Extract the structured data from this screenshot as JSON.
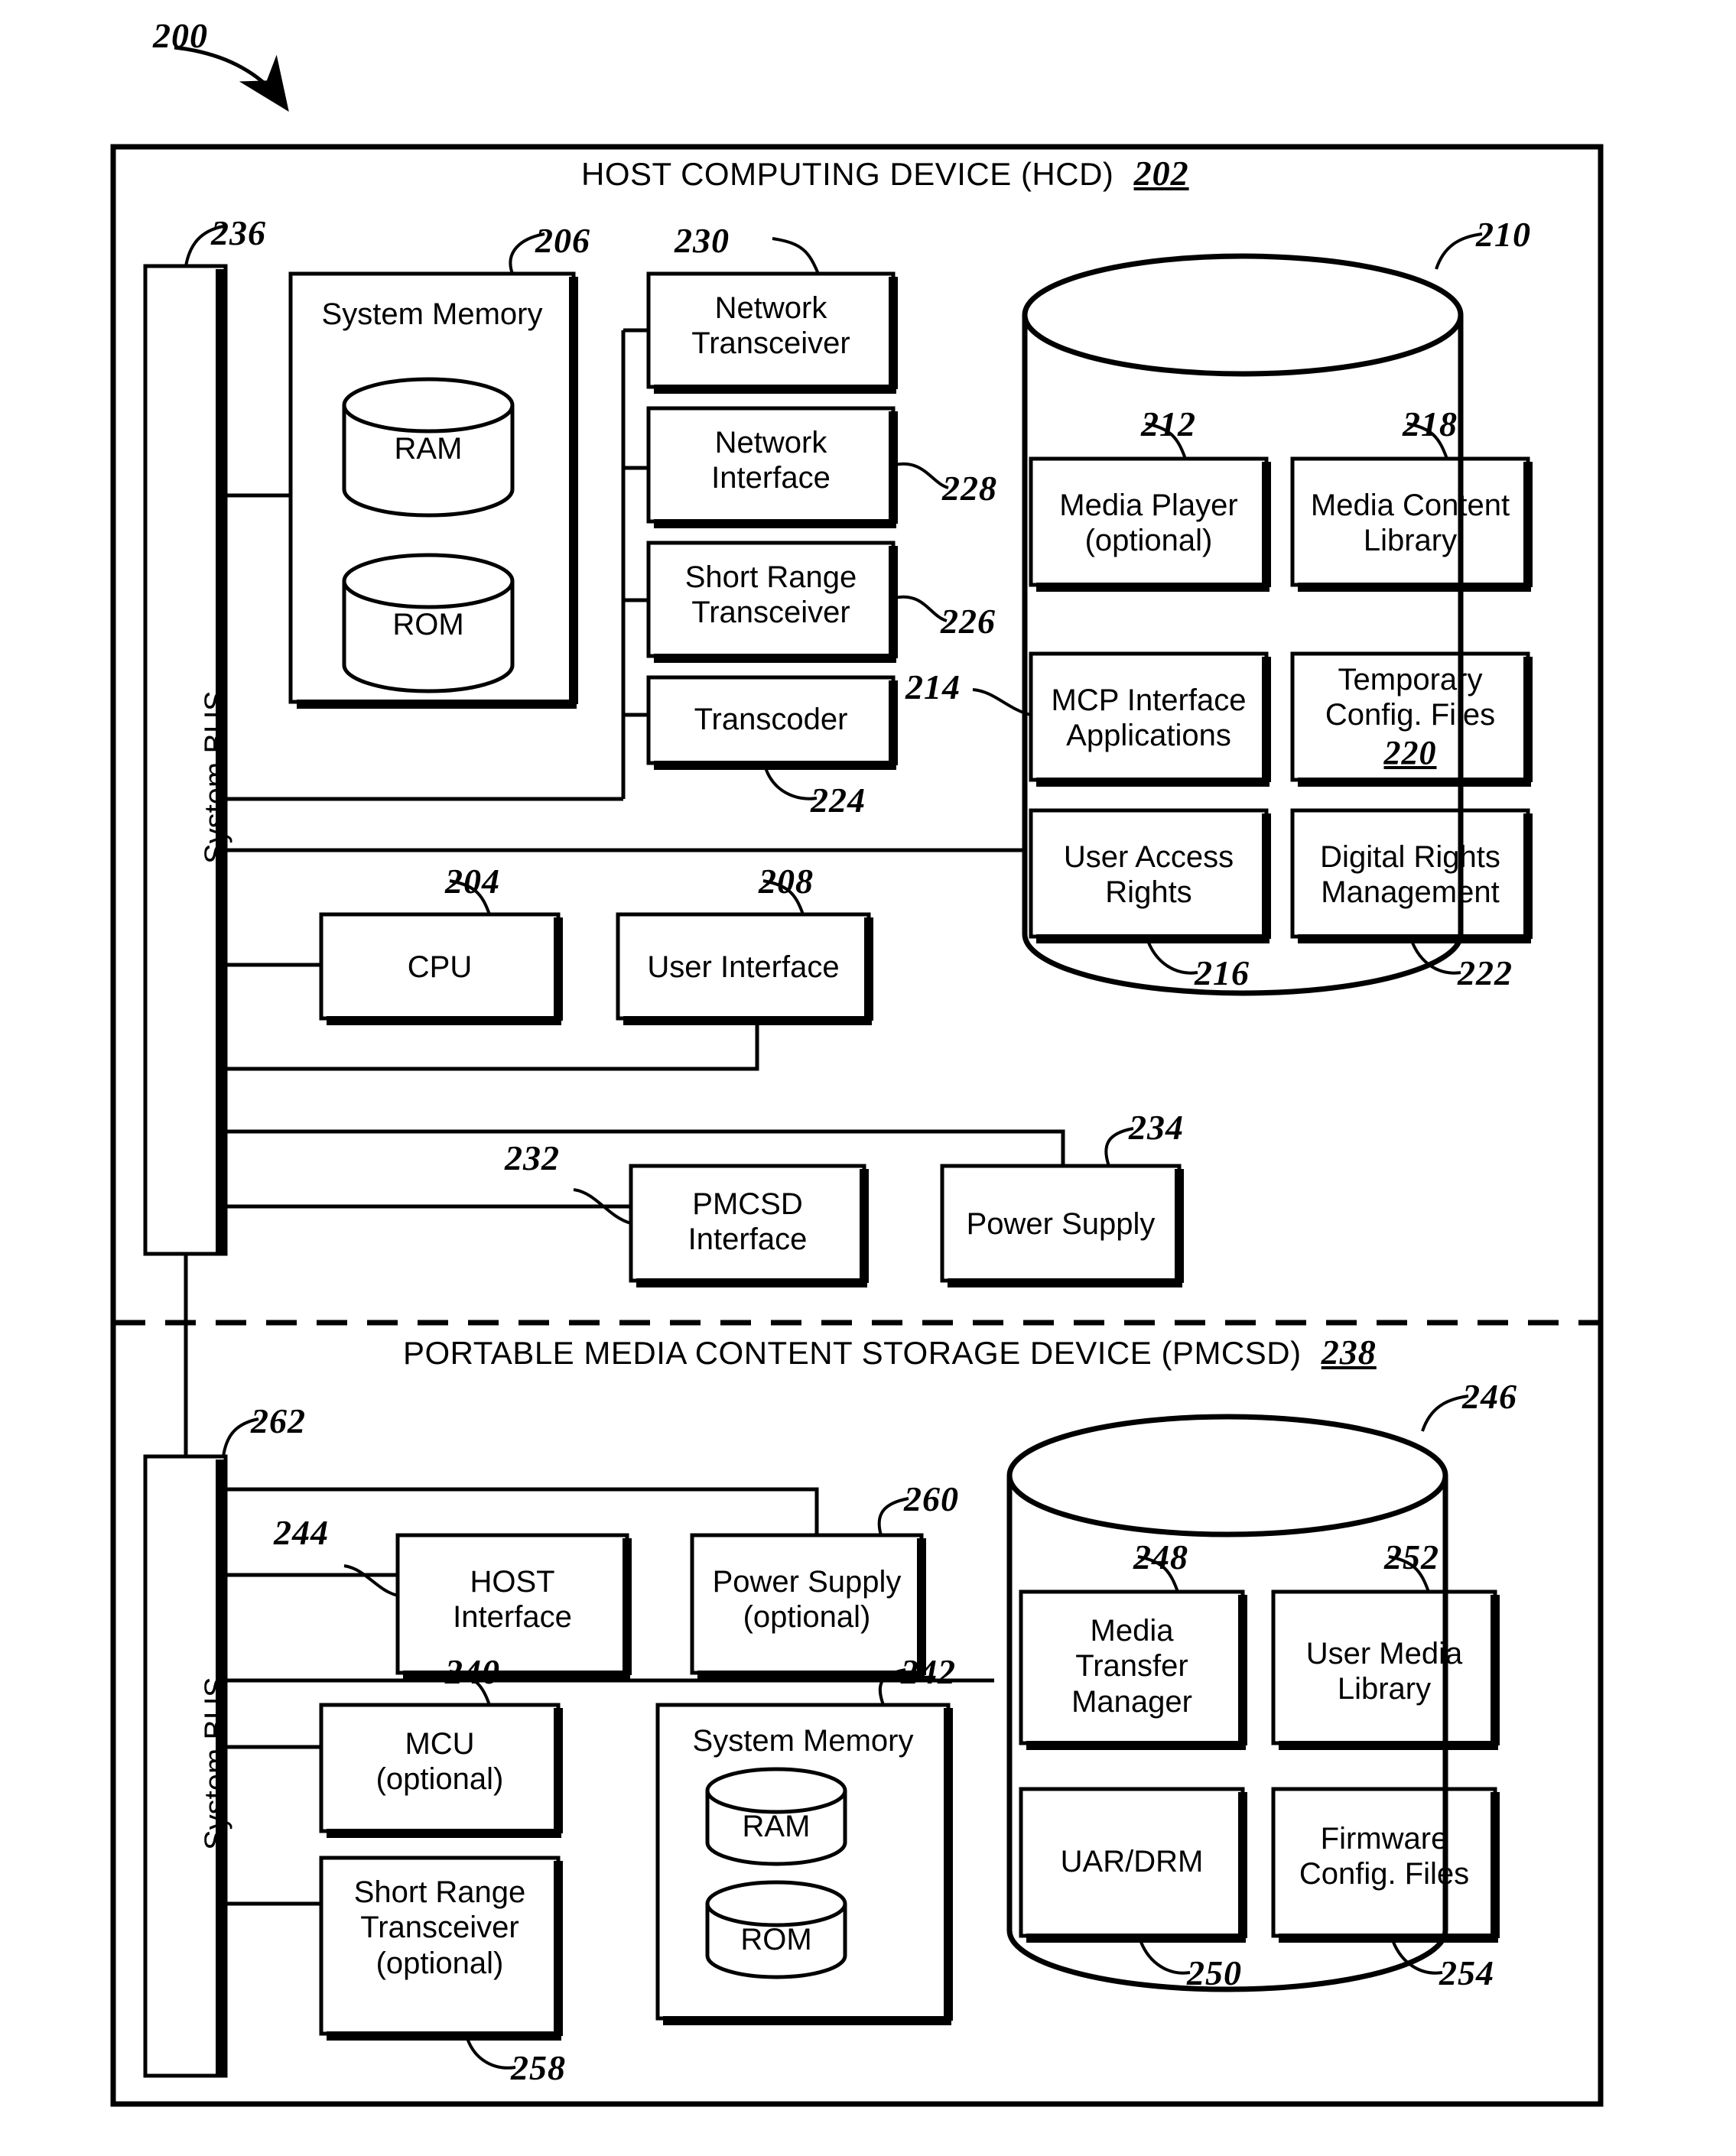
{
  "figure": {
    "figure_ref": "200",
    "sections": [
      {
        "id": "hcd",
        "title": "HOST COMPUTING DEVICE (HCD)",
        "ref": "202"
      },
      {
        "id": "pmcsd",
        "title": "PORTABLE MEDIA CONTENT STORAGE DEVICE (PMCSD)",
        "ref": "238"
      }
    ]
  },
  "hcd": {
    "bus": {
      "label": "System BUS",
      "ref": "236"
    },
    "system_memory": {
      "label": "System Memory",
      "ref": "206",
      "cylinders": [
        {
          "label": "RAM"
        },
        {
          "label": "ROM"
        }
      ]
    },
    "stack": [
      {
        "label": "Network\nTransceiver",
        "lines": [
          "Network",
          "Transceiver"
        ],
        "ref": "230",
        "ref_pos": "top"
      },
      {
        "label": "Network\nInterface",
        "lines": [
          "Network",
          "Interface"
        ],
        "ref": "228",
        "ref_pos": "right"
      },
      {
        "label": "Short Range\nTransceiver",
        "lines": [
          "Short Range",
          "Transceiver"
        ],
        "ref": "226",
        "ref_pos": "right"
      },
      {
        "label": "Transcoder",
        "lines": [
          "Transcoder"
        ],
        "ref": "224",
        "ref_pos": "bottom"
      }
    ],
    "cpu": {
      "label": "CPU",
      "ref": "204"
    },
    "user_interface": {
      "label": "User Interface",
      "ref": "208"
    },
    "pmcsd_interface": {
      "lines": [
        "PMCSD",
        "Interface"
      ],
      "ref": "232"
    },
    "power_supply": {
      "label": "Power Supply",
      "ref": "234"
    },
    "database": {
      "ref": "210",
      "items": [
        {
          "lines": [
            "Media Player",
            "(optional)"
          ],
          "ref": "212",
          "ref_pos": "top"
        },
        {
          "lines": [
            "Media Content",
            "Library"
          ],
          "ref": "218",
          "ref_pos": "top"
        },
        {
          "lines": [
            "MCP Interface",
            "Applications"
          ],
          "ref": "214",
          "ref_pos": "left"
        },
        {
          "lines": [
            "Temporary",
            "Config. Files"
          ],
          "ref": "220",
          "ref_pos": "inside"
        },
        {
          "lines": [
            "User Access",
            "Rights"
          ],
          "ref": "216",
          "ref_pos": "bottom"
        },
        {
          "lines": [
            "Digital Rights",
            "Management"
          ],
          "ref": "222",
          "ref_pos": "bottom"
        }
      ]
    }
  },
  "pmcsd": {
    "bus": {
      "label": "System BUS",
      "ref": "262"
    },
    "host_interface": {
      "lines": [
        "HOST",
        "Interface"
      ],
      "ref": "244"
    },
    "power_supply": {
      "lines": [
        "Power Supply",
        "(optional)"
      ],
      "ref": "260"
    },
    "mcu": {
      "lines": [
        "MCU",
        "(optional)"
      ],
      "ref": "240"
    },
    "system_memory": {
      "label": "System Memory",
      "ref": "242",
      "cylinders": [
        {
          "label": "RAM"
        },
        {
          "label": "ROM"
        }
      ]
    },
    "short_range_transceiver": {
      "lines": [
        "Short Range",
        "Transceiver",
        "(optional)"
      ],
      "ref": "258"
    },
    "database": {
      "ref": "246",
      "items": [
        {
          "lines": [
            "Media",
            "Transfer",
            "Manager"
          ],
          "ref": "248",
          "ref_pos": "top"
        },
        {
          "lines": [
            "User Media",
            "Library"
          ],
          "ref": "252",
          "ref_pos": "top"
        },
        {
          "lines": [
            "UAR/DRM"
          ],
          "ref": "250",
          "ref_pos": "bottom"
        },
        {
          "lines": [
            "Firmware",
            "Config. Files"
          ],
          "ref": "254",
          "ref_pos": "bottom"
        }
      ]
    }
  },
  "colors": {
    "ink": "#000000",
    "paper": "#ffffff"
  }
}
